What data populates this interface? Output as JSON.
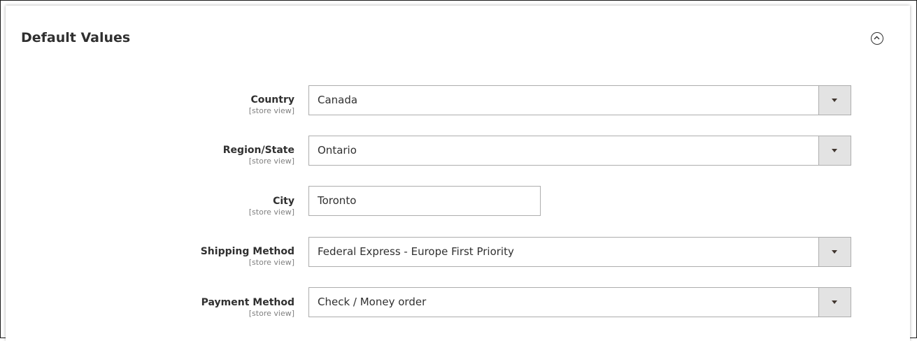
{
  "section": {
    "title": "Default Values",
    "collapse_icon": "chevron-up-circle-icon"
  },
  "fields": {
    "country": {
      "label": "Country",
      "scope": "[store view]",
      "value": "Canada"
    },
    "region": {
      "label": "Region/State",
      "scope": "[store view]",
      "value": "Ontario"
    },
    "city": {
      "label": "City",
      "scope": "[store view]",
      "value": "Toronto"
    },
    "shipping": {
      "label": "Shipping Method",
      "scope": "[store view]",
      "value": "Federal Express - Europe First Priority"
    },
    "payment": {
      "label": "Payment Method",
      "scope": "[store view]",
      "value": "Check / Money order"
    }
  },
  "colors": {
    "text": "#303030",
    "scope_text": "#808080",
    "border": "#adadad",
    "arrow_bg": "#e3e3e3"
  }
}
